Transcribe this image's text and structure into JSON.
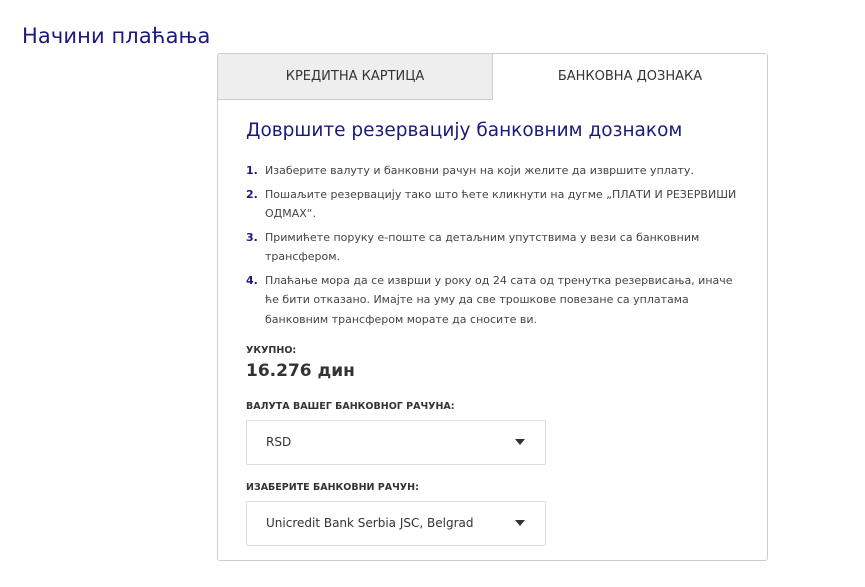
{
  "page": {
    "title": "Начини плаћања"
  },
  "tabs": [
    {
      "label": "КРЕДИТНА КАРТИЦА",
      "active": false
    },
    {
      "label": "БАНКОВНА ДОЗНАКА",
      "active": true
    }
  ],
  "bank_transfer": {
    "heading": "Довршите резервацију банковним дознаком",
    "steps": [
      {
        "num": "1.",
        "text": "Изаберите валуту и банковни рачун на који желите да извршите уплату."
      },
      {
        "num": "2.",
        "text": "Пошаљите резервацију тако што ћете кликнути на дугме „ПЛАТИ И РЕЗЕРВИШИ ОДМАХ“."
      },
      {
        "num": "3.",
        "text": "Примићете поруку е-поште са детаљним упутствима у вези са банковним трансфером."
      },
      {
        "num": "4.",
        "text": "Плаћање мора да се изврши у року од 24 сата од тренутка резервисања, иначе ће бити отказано. Имајте на уму да све трошкове повезане са уплатама банковним трансфером морате да сносите ви."
      }
    ],
    "total_label": "УКУПНО:",
    "total_value": "16.276 дин",
    "currency_label": "ВАЛУТА ВАШЕГ БАНКОВНОГ РАЧУНА:",
    "currency_value": "RSD",
    "account_label": "ИЗАБЕРИТЕ БАНКОВНИ РАЧУН:",
    "account_value": "Unicredit Bank Serbia JSC, Belgrad"
  },
  "colors": {
    "accent": "#1a1a7e",
    "inactive_tab_bg": "#eeeeee",
    "border": "#cccccc"
  },
  "icons": {
    "dropdown": "caret-down-icon"
  }
}
